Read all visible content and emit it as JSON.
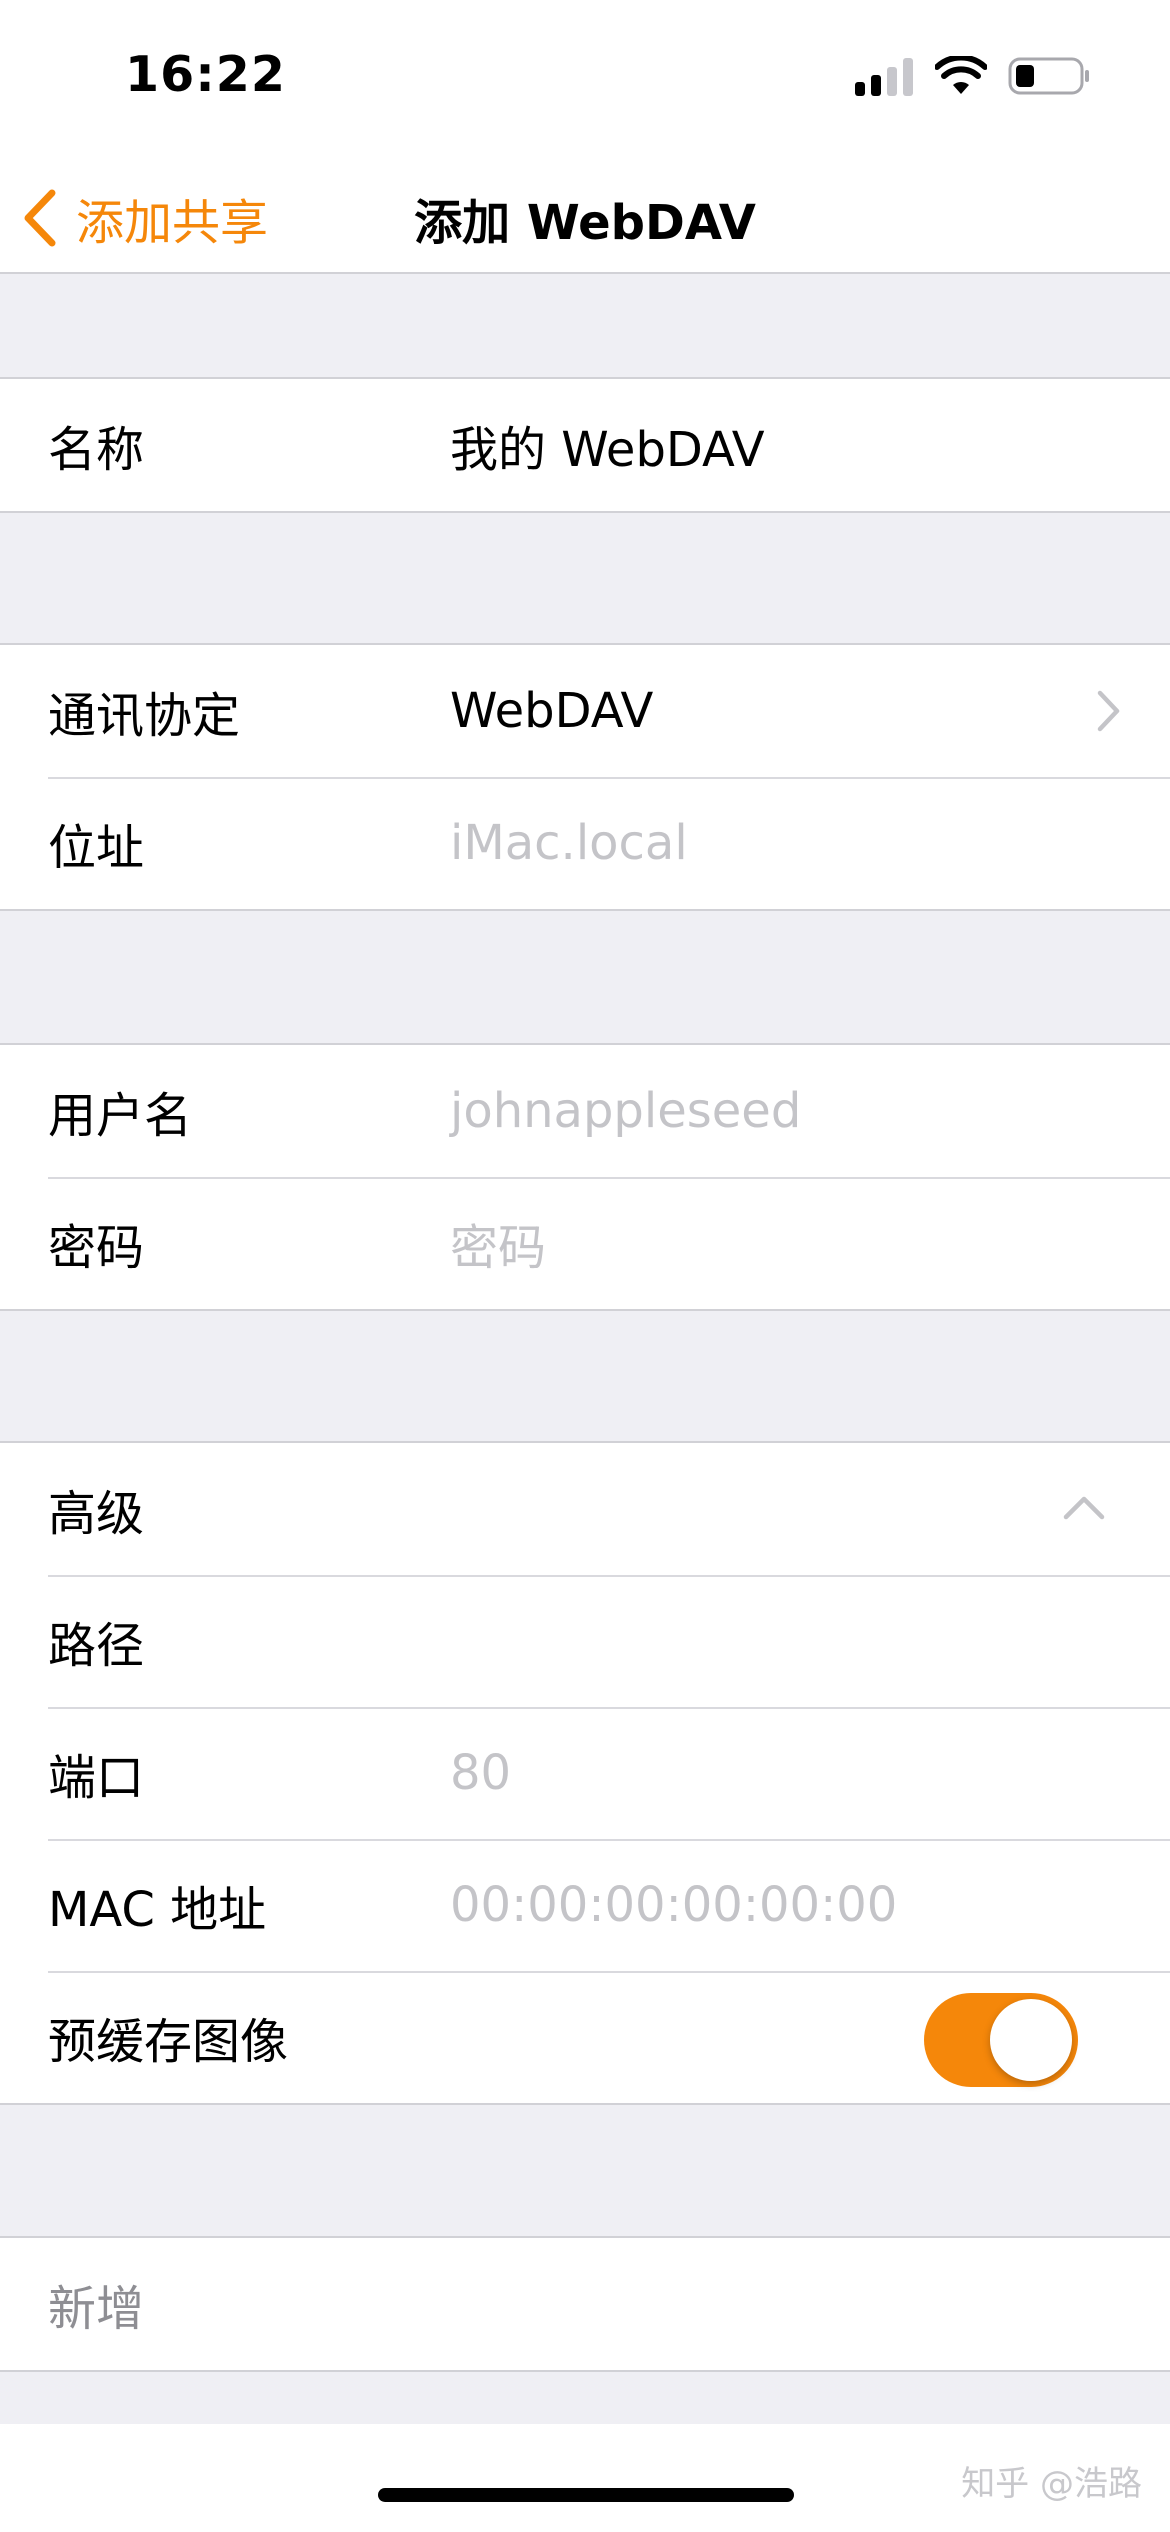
{
  "status_bar": {
    "time": "16:22",
    "icons": [
      "cellular-signal-icon",
      "wifi-icon",
      "battery-icon"
    ]
  },
  "nav": {
    "back_label": "添加共享",
    "title": "添加 WebDAV",
    "accent_color": "#f5870a"
  },
  "groups": {
    "name": {
      "label": "名称",
      "value": "我的 WebDAV"
    },
    "protocol": {
      "label": "通讯协定",
      "value": "WebDAV"
    },
    "address": {
      "label": "位址",
      "placeholder": "iMac.local"
    },
    "username": {
      "label": "用户名",
      "placeholder": "johnappleseed"
    },
    "password": {
      "label": "密码",
      "placeholder": "密码"
    },
    "advanced": {
      "label": "高级",
      "expanded": true,
      "path": {
        "label": "路径"
      },
      "port": {
        "label": "端口",
        "placeholder": "80"
      },
      "mac": {
        "label": "MAC 地址",
        "placeholder": "00:00:00:00:00:00"
      },
      "precache": {
        "label": "预缓存图像",
        "enabled": true
      }
    }
  },
  "add_button": {
    "label": "新增"
  },
  "watermark": "知乎 @浩路"
}
